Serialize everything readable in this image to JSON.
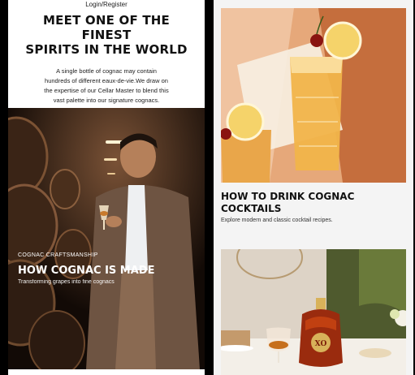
{
  "left": {
    "login_label": "Login/Register",
    "hero_title_line1": "MEET ONE OF THE FINEST",
    "hero_title_line2": "SPIRITS IN THE WORLD",
    "hero_body_line1": "A single bottle of cognac may contain",
    "hero_body_line2": "hundreds of different eaux-de-vie.We draw on",
    "hero_body_line3": "the expertise of our Cellar Master to blend this",
    "hero_body_line4": "vast palette into our signature cognacs.",
    "feature": {
      "eyebrow": "COGNAC CRAFTSMANSHIP",
      "title": "HOW COGNAC IS MADE",
      "subtitle": "Transforming grapes into fine cognacs"
    }
  },
  "right": {
    "card1": {
      "title_line1": "HOW TO DRINK COGNAC",
      "title_line2": "COCKTAILS",
      "description": "Explore modern and classic cocktail recipes."
    },
    "bottle_label": "XO"
  }
}
